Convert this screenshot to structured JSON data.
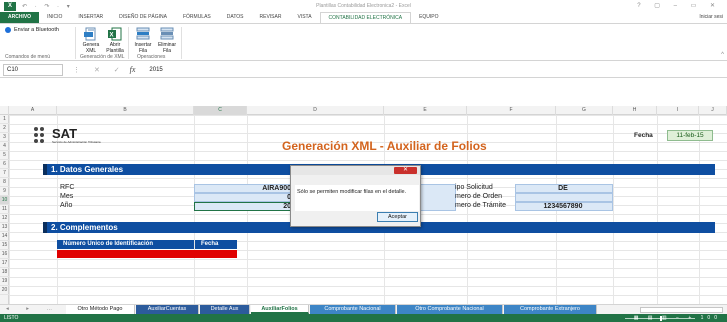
{
  "window": {
    "title": "Plantillas Contabilidad Electronica2 - Excel",
    "controls": "? ▢ – ▭ ✕"
  },
  "quick_access": "↶ · ↷ · ▾",
  "ribbon_tabs": [
    "ARCHIVO",
    "INICIO",
    "INSERTAR",
    "DISEÑO DE PÁGINA",
    "FÓRMULAS",
    "DATOS",
    "REVISAR",
    "VISTA",
    "CONTABILIDAD ELECTRÓNICA",
    "EQUIPO"
  ],
  "active_tab": "CONTABILIDAD ELECTRÓNICA",
  "signin": "Iniciar sesi",
  "ribbon": {
    "bluetooth": "Enviar a Bluetooth",
    "buttons": [
      {
        "line1": "Genera",
        "line2": "XML",
        "icon": "xml-generate-icon"
      },
      {
        "line1": "Abrir",
        "line2": "Plantilla",
        "icon": "excel-open-icon"
      },
      {
        "line1": "Insertar",
        "line2": "Fila",
        "icon": "insert-row-icon"
      },
      {
        "line1": "Eliminar",
        "line2": "Fila",
        "icon": "delete-row-icon"
      }
    ],
    "groups": [
      "Comandos de menú",
      "Generación de XML",
      "Operaciones"
    ]
  },
  "formula_bar": {
    "cell_ref": "C10",
    "value": "2015",
    "fx": "fx"
  },
  "columns": [
    "A",
    "B",
    "C",
    "D",
    "E",
    "F",
    "G",
    "H",
    "I",
    "J"
  ],
  "rows": [
    "1",
    "2",
    "3",
    "4",
    "5",
    "6",
    "7",
    "8",
    "9",
    "10",
    "11",
    "12",
    "13",
    "14",
    "15",
    "16",
    "17",
    "18",
    "19",
    "20"
  ],
  "sheet": {
    "logo_text": "SAT",
    "logo_sub": "Servicio de Administración Tributaria",
    "title": "Generación XML - Auxiliar de Folios",
    "fecha_label": "Fecha",
    "fecha_value": "11-feb-15",
    "section1": "1. Datos Generales",
    "section2": "2. Complementos",
    "labels": {
      "rfc": "RFC",
      "mes": "Mes",
      "anio": "Año",
      "tipo": "ipo Solicitud",
      "orden": "mero de Orden",
      "tramite": "mero de Trámite"
    },
    "values": {
      "rfc": "AIRA900",
      "mes": "0",
      "anio": "20",
      "tipo": "DE",
      "tramite": "1234567890"
    },
    "table_headers": [
      "Número Único de Identificación",
      "Fecha"
    ]
  },
  "dialog": {
    "close": "✕",
    "message": "Sólo se permiten modificar filas en el detalle.",
    "ok": "Aceptar"
  },
  "sheet_tabs": [
    "Otro Método Pago",
    "AuxiliarCuentas",
    "Detalle Aux",
    "AuxiliarFolios",
    "Comprobante Nacional",
    "Otro Comprobante Nacional",
    "Comprobante Extranjero"
  ],
  "active_sheet": "AuxiliarFolios",
  "sheet_nav": "◂ ▸ …",
  "status": {
    "ready": "LISTO",
    "right": "▦ ▤ ▥ − + 100"
  },
  "colors": {
    "excel_green": "#217346",
    "section_blue": "#0e4ea1",
    "title_orange": "#d3641e",
    "red_row": "#e00000"
  }
}
